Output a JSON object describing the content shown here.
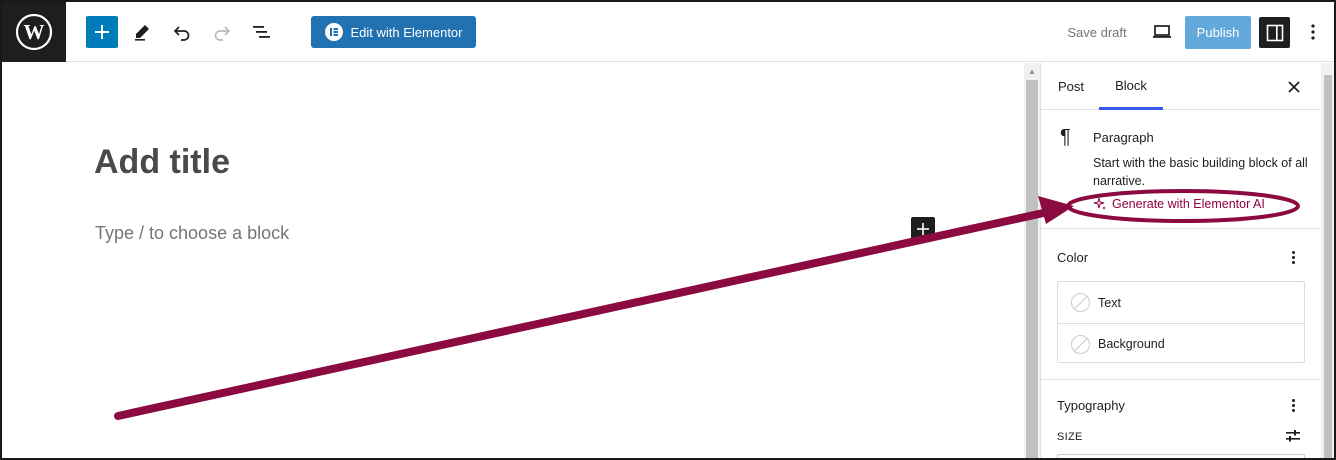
{
  "toolbar": {
    "elementor_label": "Edit with Elementor",
    "save_draft_label": "Save draft",
    "publish_label": "Publish"
  },
  "editor": {
    "title_placeholder": "Add title",
    "block_placeholder": "Type / to choose a block"
  },
  "sidebar": {
    "tabs": [
      {
        "label": "Post"
      },
      {
        "label": "Block"
      }
    ],
    "active_tab": "Block",
    "block_card": {
      "title": "Paragraph",
      "description": "Start with the basic building block of all narrative.",
      "generate_ai_label": "Generate with Elementor AI"
    },
    "color_panel": {
      "title": "Color",
      "items": [
        {
          "label": "Text"
        },
        {
          "label": "Background"
        }
      ]
    },
    "typography_panel": {
      "title": "Typography",
      "size_label": "SIZE"
    }
  },
  "colors": {
    "wp_dark": "#1e1e1e",
    "primary_blue": "#007cba",
    "elementor_blue": "#2271b1",
    "publish_disabled": "#63a8da",
    "ai_accent": "#93003f",
    "annotation": "#8b0a3f"
  },
  "icons": [
    "wordpress-logo-icon",
    "plus-icon",
    "pen-icon",
    "undo-icon",
    "redo-icon",
    "list-view-icon",
    "elementor-icon",
    "desktop-preview-icon",
    "settings-sidebar-icon",
    "more-vertical-icon",
    "close-icon",
    "paragraph-icon",
    "sparkle-icon",
    "typography-controls-icon"
  ]
}
